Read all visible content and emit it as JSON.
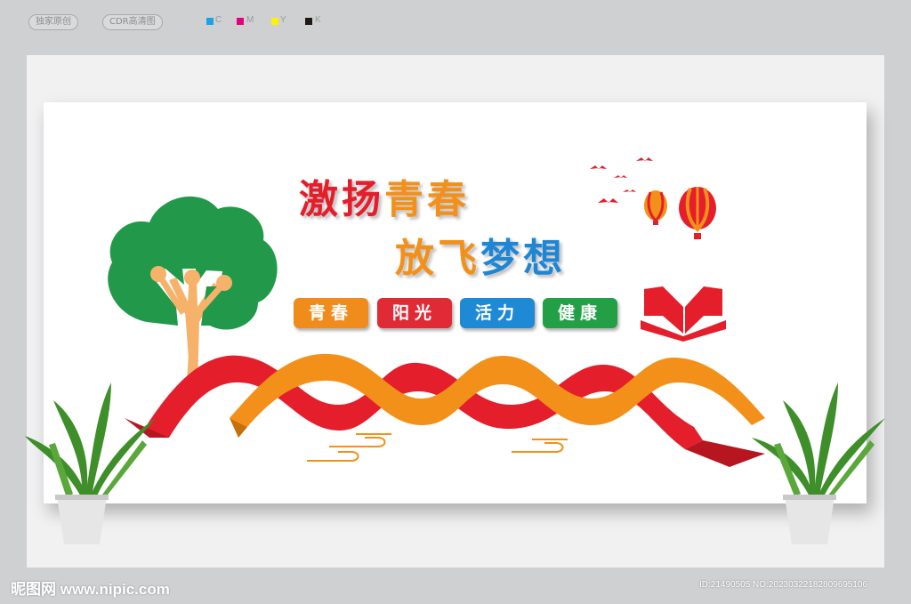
{
  "top_tags": [
    "独家原创",
    "CDR高清图"
  ],
  "color_swatches": [
    {
      "label": "C",
      "color": "#1aa3e8"
    },
    {
      "label": "M",
      "color": "#e4007f"
    },
    {
      "label": "Y",
      "color": "#fff100"
    },
    {
      "label": "K",
      "color": "#231815"
    }
  ],
  "headline": {
    "line1_part1": "激扬",
    "line1_part2": "青春",
    "line2_part1": "放飞",
    "line2_part2": "梦想"
  },
  "tags": [
    {
      "label": "青春",
      "color": "#f08c1c"
    },
    {
      "label": "阳光",
      "color": "#e02a35"
    },
    {
      "label": "活力",
      "color": "#1e8ad6"
    },
    {
      "label": "健康",
      "color": "#23a046"
    }
  ],
  "colors": {
    "red": "#e41e2b",
    "orange": "#f39019",
    "blue": "#1f86d4",
    "green": "#1f9a46",
    "tree_trunk": "#f6b26b"
  },
  "footer": {
    "site": "昵图网 www.nipic.com",
    "id_text": "ID:21490505 NO:20230322182809695106"
  }
}
